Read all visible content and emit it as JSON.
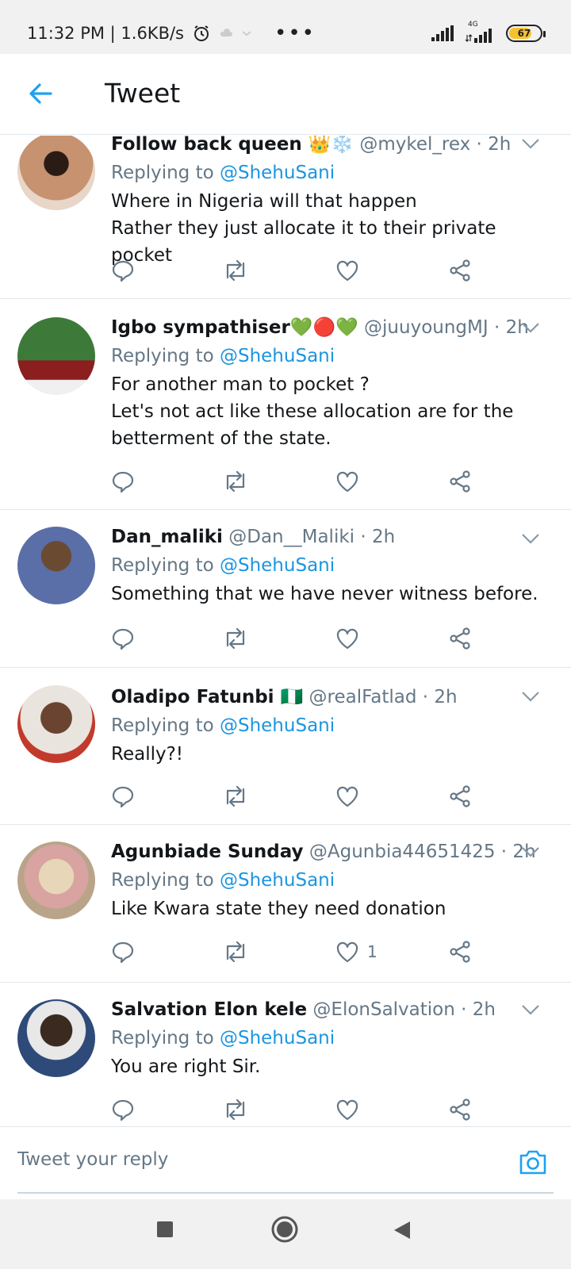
{
  "status_bar": {
    "time_speed": "11:32 PM | 1.6KB/s",
    "network": "4G",
    "battery": "67",
    "more_icon": "more-dots-icon"
  },
  "header": {
    "title": "Tweet",
    "back_icon": "back-arrow-icon"
  },
  "colors": {
    "accent": "#1da1f2",
    "mention": "#1b95e0",
    "secondary_text": "#657786",
    "divider": "#e1e8ed",
    "like_outline": "#657786"
  },
  "tweets": [
    {
      "name": "Follow back queen 👑❄️",
      "handle": "@mykel_rex · 2h",
      "replying_prefix": "Replying to ",
      "replying_to": "@ShehuSani",
      "text": "Where in Nigeria will that happen\nRather they just allocate it to their private pocket",
      "likes": ""
    },
    {
      "name": "Igbo sympathiser💚🔴💚",
      "handle": "@juuyoungMJ · 2h",
      "replying_prefix": "Replying to ",
      "replying_to": "@ShehuSani",
      "text": "For another man to pocket ?\nLet's  not act like these allocation are for the betterment of the state.",
      "likes": ""
    },
    {
      "name": "Dan_maliki",
      "handle": "@Dan__Maliki · 2h",
      "replying_prefix": "Replying to ",
      "replying_to": "@ShehuSani",
      "text": "Something that we have never witness before.",
      "likes": ""
    },
    {
      "name": "Oladipo Fatunbi 🇳🇬",
      "handle": "@realFatlad · 2h",
      "replying_prefix": "Replying to ",
      "replying_to": "@ShehuSani",
      "text": "Really?!",
      "likes": ""
    },
    {
      "name": "Agunbiade Sunday",
      "handle": "@Agunbia44651425 · 2h",
      "replying_prefix": "Replying to ",
      "replying_to": "@ShehuSani",
      "text": "Like Kwara state they need donation",
      "likes": "1"
    },
    {
      "name": "Salvation Elon kele",
      "handle": "@ElonSalvation · 2h",
      "replying_prefix": "Replying to ",
      "replying_to": "@ShehuSani",
      "text": "You are right Sir.",
      "likes": ""
    }
  ],
  "reply": {
    "placeholder": "Tweet your reply",
    "camera_icon": "camera-icon"
  },
  "nav": {
    "recents_icon": "square-icon",
    "home_icon": "circle-icon",
    "back_icon": "triangle-back-icon"
  }
}
